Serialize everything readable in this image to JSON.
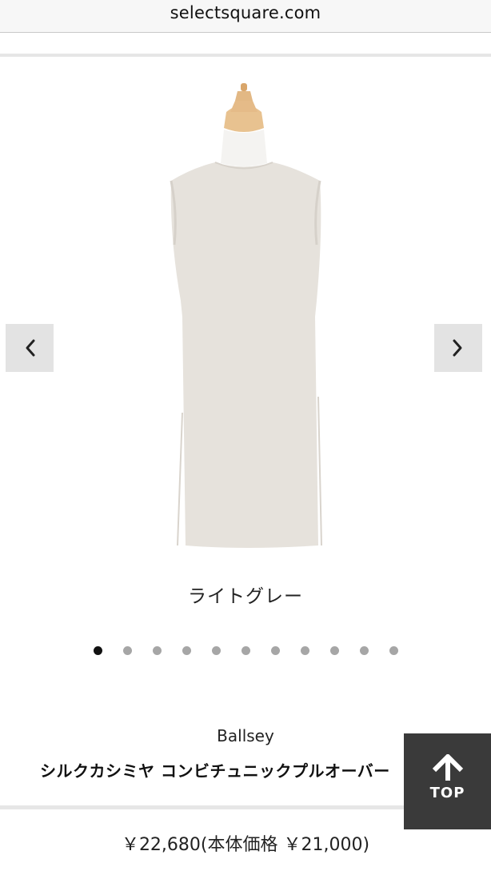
{
  "browser": {
    "url": "selectsquare.com"
  },
  "gallery": {
    "prev_icon": "chevron-left-icon",
    "next_icon": "chevron-right-icon",
    "color_label": "ライトグレー",
    "dot_count": 11,
    "active_dot": 1
  },
  "product": {
    "brand": "Ballsey",
    "name": "シルクカシミヤ コンビチュニックプルオーバー",
    "price": "￥22,680(本体価格 ￥21,000)"
  },
  "top_button": {
    "icon": "arrow-up-icon",
    "label": "TOP"
  },
  "colors": {
    "dress": "#e6e2dc",
    "mannequin_head": "#e2b884",
    "nav_bg": "#e3e3e3",
    "top_bg": "#3a3a3a"
  }
}
